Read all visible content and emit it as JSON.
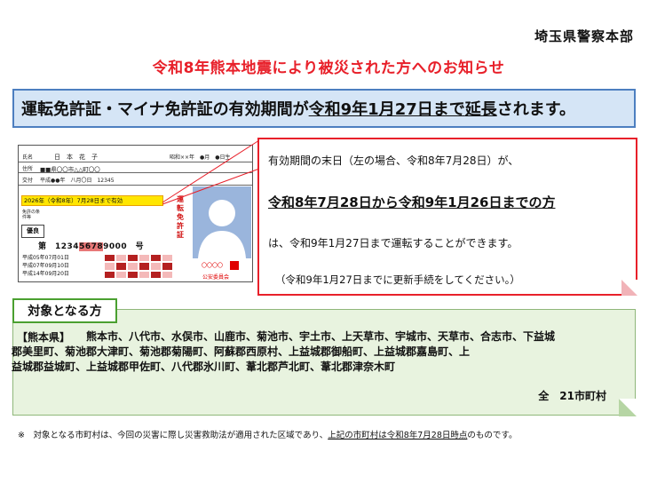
{
  "header": {
    "organization": "埼玉県警察本部",
    "title": "令和8年熊本地震により被災された方へのお知らせ"
  },
  "banner": {
    "part1": "運転免許証・マイナ免許証の有効期間が",
    "part2": "令和9年1月27日まで",
    "part3": "延長",
    "part4": "されます。"
  },
  "card": {
    "name_label": "氏名",
    "name_value": "日　本　花　子",
    "birth": "昭和××年　●月　●日生",
    "address_label": "住所",
    "address_value": "■■県〇〇市△△町〇〇",
    "issue_label": "交付",
    "issue_value": "平成●●年　八月〇日　12345",
    "expiry": "2026年（令和8年）7月28日まで有効",
    "condition_label": "免許の条件等",
    "gold": "優良",
    "number_prefix": "第　1234",
    "number_highlight": "5678",
    "number_suffix": "9000　号",
    "date1": "平成05年07月01日",
    "date2": "平成07年09月10日",
    "date3": "平成14年09月20日",
    "vertical_text": "運転免許証",
    "authority_circles": "〇〇〇〇",
    "authority": "公安委員会"
  },
  "info": {
    "line1": "有効期間の末日（左の場合、令和8年7月28日）が、",
    "line2": "令和8年7月28日から令和9年1月26日までの方",
    "line3": "は、令和9年1月27日まで運転することができます。",
    "line4": "（令和9年1月27日までに更新手続をしてください。）"
  },
  "target": {
    "label": "対象となる方",
    "prefecture": "【熊本県】",
    "line1": "熊本市、八代市、水俣市、山鹿市、菊池市、宇土市、上天草市、宇城市、天草市、合志市、下益城",
    "line2": "郡美里町、菊池郡大津町、菊池郡菊陽町、阿蘇郡西原村、上益城郡御船町、上益城郡嘉島町、上",
    "line3": "益城郡益城町、上益城郡甲佐町、八代郡氷川町、葦北郡芦北町、葦北郡津奈木町",
    "total": "全　21市町村"
  },
  "note": {
    "part1": "※　対象となる市町村は、今回の災害に際し災害救助法が適用された区域であり、",
    "part2": "上記の市町村は令和8年7月28日時点",
    "part3": "のものです。"
  },
  "colors": {
    "title_red": "#e8202a",
    "banner_blue": "#d5e5f6",
    "target_green": "#e8f3df",
    "highlight_yellow": "#ffe600"
  }
}
